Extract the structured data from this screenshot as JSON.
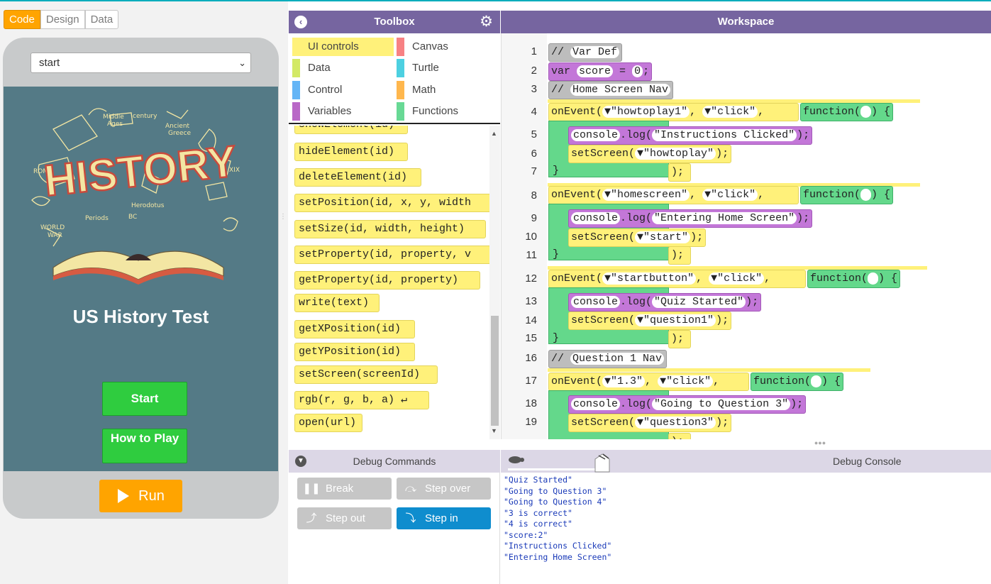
{
  "modes": [
    "Code",
    "Design",
    "Data"
  ],
  "app": {
    "screen_select": "start",
    "title": "US History Test",
    "start_button": "Start",
    "howto_button": "How to Play",
    "run_button": "Run"
  },
  "toolbox": {
    "title": "Toolbox",
    "categories": [
      {
        "label": "UI controls",
        "color": "#fff17a"
      },
      {
        "label": "Canvas",
        "color": "#f78183"
      },
      {
        "label": "Data",
        "color": "#d3e965"
      },
      {
        "label": "Turtle",
        "color": "#4dd0e1"
      },
      {
        "label": "Control",
        "color": "#64b5f6"
      },
      {
        "label": "Math",
        "color": "#ffb74d"
      },
      {
        "label": "Variables",
        "color": "#b968c7"
      },
      {
        "label": "Functions",
        "color": "#68d995"
      }
    ],
    "blocks": [
      "showElement(id)",
      "hideElement(id)",
      "deleteElement(id)",
      "setPosition(id, x, y, width",
      "setSize(id, width, height)",
      "setProperty(id, property, v",
      "getProperty(id, property)",
      "write(text)",
      "getXPosition(id)",
      "getYPosition(id)",
      "setScreen(screenId)",
      "rgb(r, g, b, a) ↵",
      "open(url)"
    ]
  },
  "workspace": {
    "title": "Workspace",
    "line_numbers": [
      "1",
      "2",
      "3",
      "4",
      "5",
      "6",
      "7",
      "8",
      "9",
      "10",
      "11",
      "12",
      "13",
      "14",
      "15",
      "16",
      "17",
      "18",
      "19"
    ],
    "comment1": "Var Def",
    "var_kw": "var",
    "var_name": "score",
    "var_val": "0",
    "comment2": "Home Screen Nav",
    "comment3": "Question 1 Nav",
    "events": [
      {
        "id": "\"howtoplay1\"",
        "evt": "\"click\"",
        "log": "\"Instructions Clicked\"",
        "screen": "\"howtoplay\""
      },
      {
        "id": "\"homescreen\"",
        "evt": "\"click\"",
        "log": "\"Entering Home Screen\"",
        "screen": "\"start\""
      },
      {
        "id": "\"startbutton\"",
        "evt": "\"click\"",
        "log": "\"Quiz Started\"",
        "screen": "\"question1\""
      },
      {
        "id": "\"1.3\"",
        "evt": "\"click\"",
        "log": "\"Going to Question 3\"",
        "screen": "\"question3\""
      }
    ],
    "kw_onevent": "onEvent",
    "kw_function": "function",
    "kw_console": "console",
    "kw_log": ".log",
    "kw_setscreen": "setScreen"
  },
  "debug": {
    "commands_title": "Debug Commands",
    "console_title": "Debug Console",
    "buttons": [
      "Break",
      "Step over",
      "Step out",
      "Step in"
    ],
    "console_lines": [
      "\"Quiz Started\"",
      "\"Going to Question 3\"",
      "\"Going to Question 4\"",
      "\"3 is correct\"",
      "\"4 is correct\"",
      "\"score:2\"",
      "\"Instructions Clicked\"",
      "\"Entering Home Screen\""
    ]
  }
}
